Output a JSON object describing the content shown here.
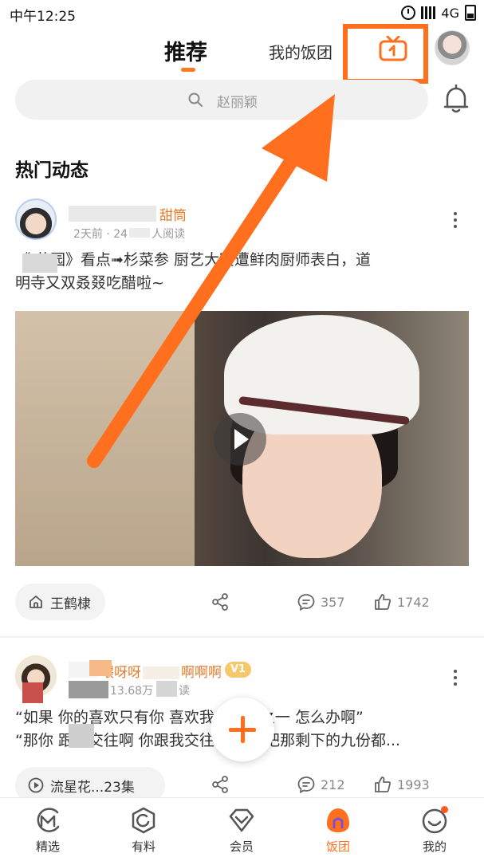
{
  "status_bar": {
    "time": "中午12:25",
    "network": "4G"
  },
  "top_nav": {
    "tab_recommend": "推荐",
    "tab_my_fantuan": "我的饭团"
  },
  "search": {
    "placeholder": "赵丽颖"
  },
  "section_title": "热门动态",
  "post1": {
    "author": "甜筒",
    "meta": "2天前 · 24",
    "meta_suffix": "人阅读",
    "text_line1": "《 花园》看点➟杉菜参 厨艺大赛遭鲜肉厨师表白，道",
    "text_line2": "明寺又双叒叕吃醋啦~",
    "tag": "王鹤棣",
    "shares": "",
    "comments": "357",
    "likes": "1742"
  },
  "post2": {
    "author_a": "喂呀呀",
    "author_b": "啊啊啊",
    "badge": "V1",
    "meta": "13.68万",
    "meta_suffix": "读",
    "text_line1": "“如果 你的喜欢只有你 喜欢我的十分之一 怎么办啊”",
    "text_line2": "“那你 跟我交往啊 你跟我交往以后 我把那剩下的九份都...",
    "tag": "流星花...23集",
    "comments": "212",
    "likes": "1993"
  },
  "bottom_nav": [
    {
      "label": "精选",
      "icon": "m-logo-icon",
      "active": false
    },
    {
      "label": "有料",
      "icon": "circle-face-icon",
      "active": false
    },
    {
      "label": "会员",
      "icon": "diamond-icon",
      "active": false
    },
    {
      "label": "饭团",
      "icon": "fantuan-icon",
      "active": true
    },
    {
      "label": "我的",
      "icon": "smile-icon",
      "active": false
    }
  ],
  "colors": {
    "accent": "#ff6f1e",
    "username": "#e87a2a",
    "badge": "#f6c86c"
  }
}
